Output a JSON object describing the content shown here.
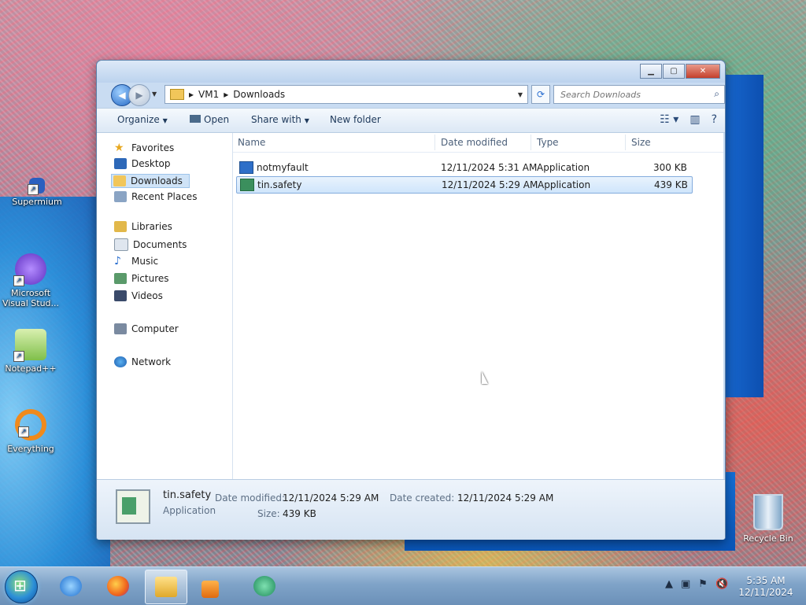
{
  "desktop": {
    "icons": [
      {
        "label": "Supermium"
      },
      {
        "label": "Microsoft Visual Stud..."
      },
      {
        "label": "Notepad++"
      },
      {
        "label": "Everything"
      }
    ],
    "recycle_bin": "Recycle Bin"
  },
  "explorer": {
    "address": {
      "root": "VM1",
      "folder": "Downloads"
    },
    "search_placeholder": "Search Downloads",
    "toolbar": {
      "organize": "Organize",
      "open": "Open",
      "share_with": "Share with",
      "new_folder": "New folder"
    },
    "nav": {
      "favorites": "Favorites",
      "desktop": "Desktop",
      "downloads": "Downloads",
      "recent_places": "Recent Places",
      "libraries": "Libraries",
      "documents": "Documents",
      "music": "Music",
      "pictures": "Pictures",
      "videos": "Videos",
      "computer": "Computer",
      "network": "Network"
    },
    "columns": {
      "name": "Name",
      "date_modified": "Date modified",
      "type": "Type",
      "size": "Size"
    },
    "files": [
      {
        "name": "notmyfault",
        "date": "12/11/2024 5:31 AM",
        "type": "Application",
        "size": "300 KB"
      },
      {
        "name": "tin.safety",
        "date": "12/11/2024 5:29 AM",
        "type": "Application",
        "size": "439 KB"
      }
    ],
    "details": {
      "name": "tin.safety",
      "type": "Application",
      "modified_label": "Date modified:",
      "modified_value": "12/11/2024 5:29 AM",
      "size_label": "Size:",
      "size_value": "439 KB",
      "created_label": "Date created:",
      "created_value": "12/11/2024 5:29 AM"
    }
  },
  "taskbar": {
    "clock_time": "5:35 AM",
    "clock_date": "12/11/2024"
  }
}
